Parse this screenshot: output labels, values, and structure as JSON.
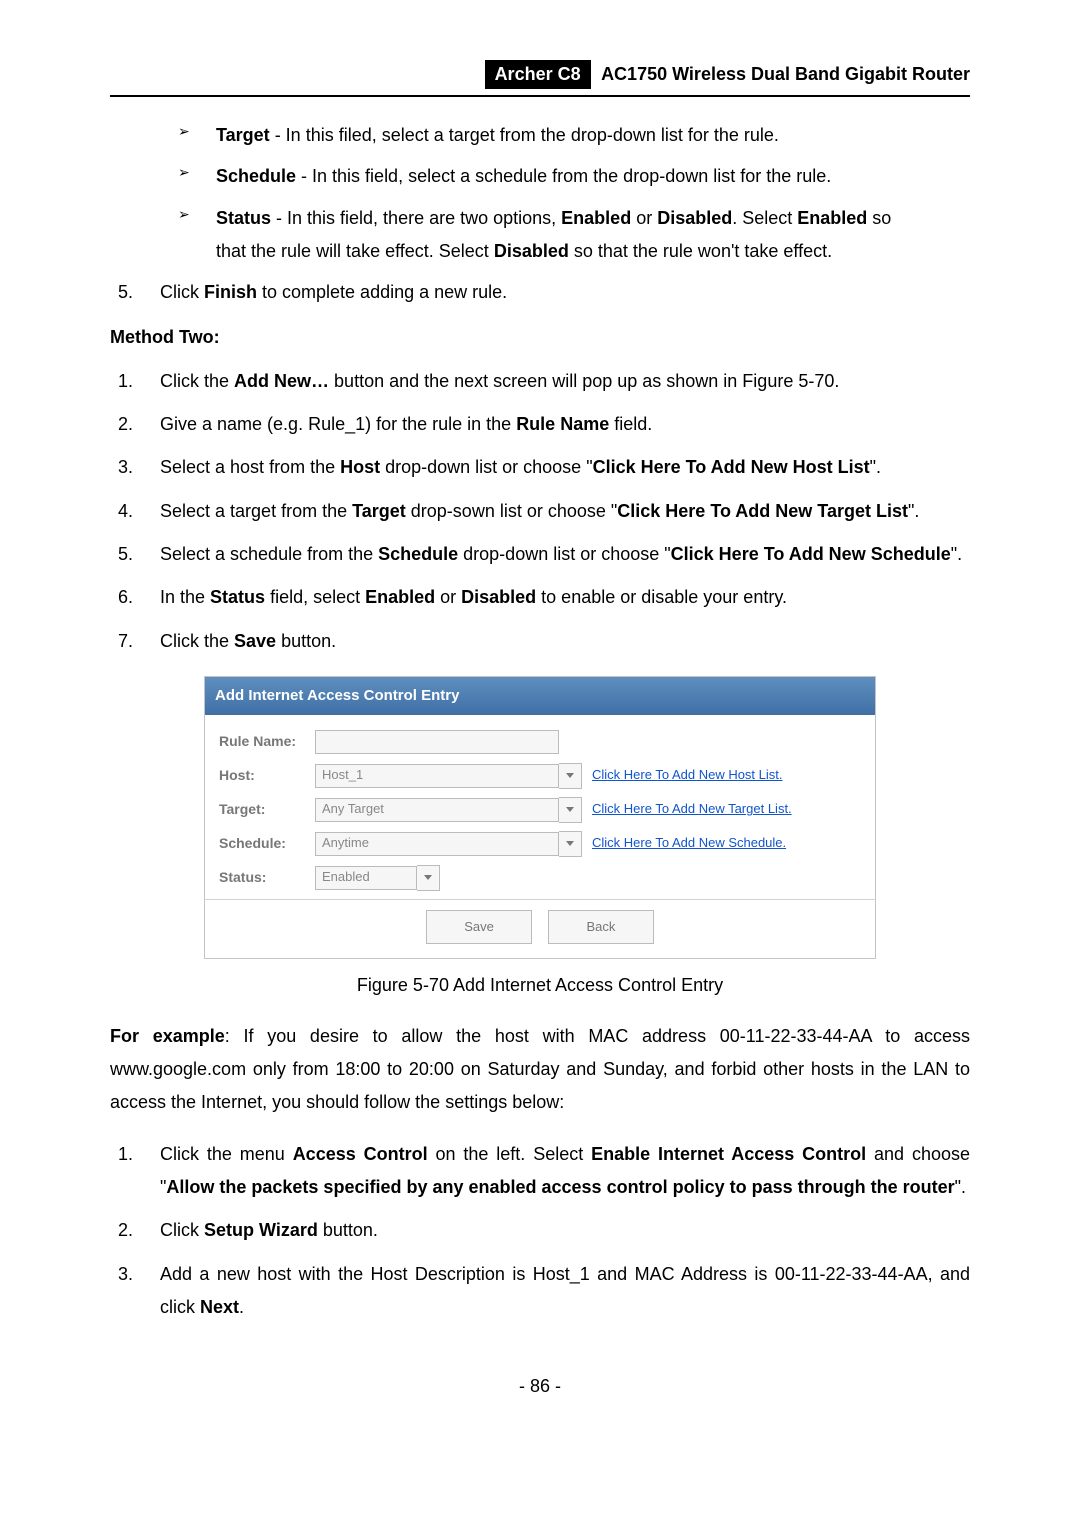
{
  "header": {
    "model": "Archer C8",
    "title": "AC1750 Wireless Dual Band Gigabit Router"
  },
  "top_bullets": {
    "target_bold": "Target",
    "target_text": " - In this filed, select a target from the drop-down list for the rule.",
    "schedule_bold": "Schedule",
    "schedule_text": " - In this field, select a schedule from the drop-down list for the rule.",
    "status_bold": "Status",
    "status_pre": " - In this field, there are two options, ",
    "enabled": "Enabled",
    "or": " or ",
    "disabled": "Disabled",
    "select": ". Select ",
    "enabled2": "Enabled",
    "status_line1_tail": " so",
    "status_line2_pre": "that the rule will take effect. Select ",
    "disabled2": "Disabled",
    "status_line2_tail": " so that the rule won't take effect."
  },
  "step5": {
    "pre": "Click ",
    "finish": "Finish",
    "post": " to complete adding a new rule."
  },
  "method_two": "Method Two:",
  "m2": {
    "s1_pre": "Click the ",
    "s1_bold": "Add New…",
    "s1_post": " button and the next screen will pop up as shown in Figure 5-70.",
    "s2_pre": "Give a name (e.g. Rule_1) for the rule in the ",
    "s2_bold": "Rule Name",
    "s2_post": " field.",
    "s3_pre": "Select a host from the ",
    "s3_bold": "Host",
    "s3_mid": " drop-down list or choose \"",
    "s3_bold2": "Click Here To Add New Host List",
    "s3_post": "\".",
    "s4_pre": "Select a target from the ",
    "s4_bold": "Target",
    "s4_mid": " drop-sown list or choose \"",
    "s4_bold2": "Click Here To Add New Target List",
    "s4_post": "\".",
    "s5_pre": "Select a schedule from the ",
    "s5_bold": "Schedule",
    "s5_mid": " drop-down list or choose \"",
    "s5_bold2": "Click Here To Add New Schedule",
    "s5_post": "\".",
    "s6_pre": "In the ",
    "s6_bold": "Status",
    "s6_mid": " field, select ",
    "s6_en": "Enabled",
    "s6_or": " or ",
    "s6_dis": "Disabled",
    "s6_post": " to enable or disable your entry.",
    "s7_pre": "Click the ",
    "s7_bold": "Save",
    "s7_post": " button."
  },
  "figure": {
    "title": "Add Internet Access Control Entry",
    "labels": {
      "rule_name": "Rule Name:",
      "host": "Host:",
      "target": "Target:",
      "schedule": "Schedule:",
      "status": "Status:"
    },
    "values": {
      "rule_name": "",
      "host": "Host_1",
      "target": "Any Target",
      "schedule": "Anytime",
      "status": "Enabled"
    },
    "links": {
      "host": "Click Here To Add New Host List.",
      "target": "Click Here To Add New Target List.",
      "schedule": "Click Here To Add New Schedule."
    },
    "buttons": {
      "save": "Save",
      "back": "Back"
    },
    "caption": "Figure 5-70 Add Internet Access Control Entry"
  },
  "example": {
    "bold": "For example",
    "text": ": If you desire to allow the host with MAC address 00-11-22-33-44-AA to access www.google.com only from 18:00 to 20:00 on Saturday and Sunday, and forbid other hosts in the LAN to access the Internet, you should follow the settings below:"
  },
  "ex_steps": {
    "s1_pre": "Click the menu ",
    "s1_b1": "Access Control",
    "s1_mid": " on the left. Select ",
    "s1_b2": "Enable Internet Access Control",
    "s1_mid2": " and choose \"",
    "s1_b3": "Allow the packets specified by any enabled access control policy to pass through the router",
    "s1_post": "\".",
    "s2_pre": "Click ",
    "s2_b": "Setup Wizard",
    "s2_post": " button.",
    "s3_pre": "Add a new host with the Host Description is Host_1 and MAC Address is 00-11-22-33-44-AA, and click ",
    "s3_b": "Next",
    "s3_post": "."
  },
  "page_number": "- 86 -"
}
